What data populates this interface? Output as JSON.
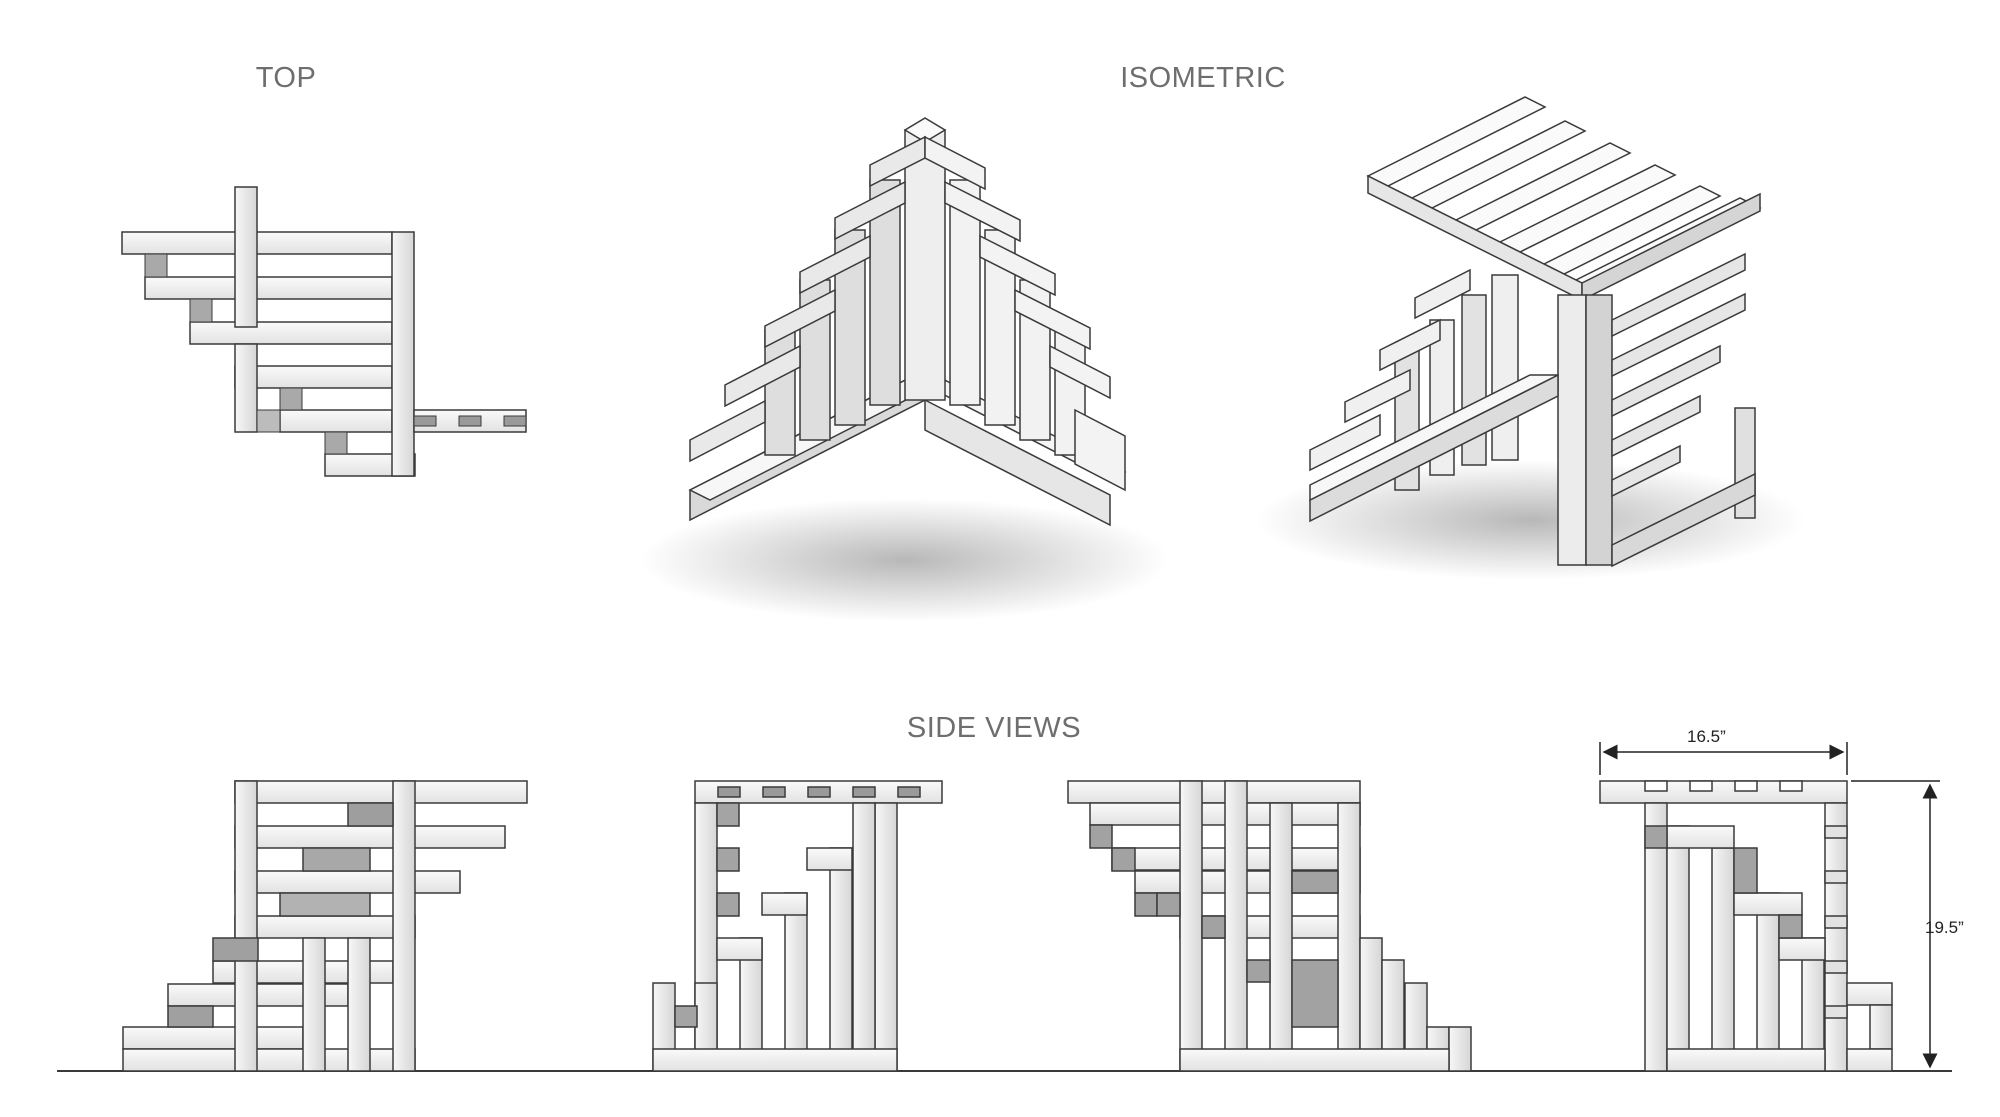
{
  "labels": {
    "top": "TOP",
    "isometric": "ISOMETRIC",
    "side_views": "SIDE VIEWS"
  },
  "dimensions": {
    "width": "16.5”",
    "height": "19.5”"
  },
  "colors": {
    "line": "#3a3a3a",
    "face_light": "#f4f4f4",
    "face_mid": "#dcdcdc",
    "face_dark": "#9a9a9a",
    "label": "#6e6e6e"
  }
}
